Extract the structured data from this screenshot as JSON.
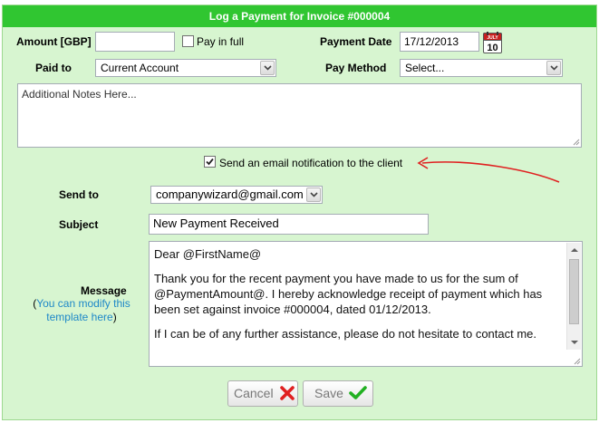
{
  "dialog": {
    "title": "Log a Payment for Invoice #000004"
  },
  "payment": {
    "amount_label": "Amount [GBP]",
    "amount_value": "",
    "pay_in_full_label": "Pay in full",
    "pay_in_full_checked": false,
    "date_label": "Payment Date",
    "date_value": "17/12/2013",
    "calendar_badge_month": "JULY",
    "calendar_badge_day": "10",
    "paid_to_label": "Paid to",
    "paid_to_value": "Current Account",
    "pay_method_label": "Pay Method",
    "pay_method_value": "Select...",
    "notes_placeholder": "Additional Notes Here..."
  },
  "email": {
    "notify_label": "Send an email notification to the client",
    "notify_checked": true,
    "send_to_label": "Send to",
    "send_to_value": "companywizard@gmail.com",
    "subject_label": "Subject",
    "subject_value": "New Payment Received",
    "message_label": "Message",
    "message_hint_open": "(",
    "message_hint_link": "You can modify this template here",
    "message_hint_close": ")",
    "message_lines": [
      "Dear @FirstName@",
      "Thank you for the recent payment you have made to us for the sum of @PaymentAmount@. I hereby acknowledge receipt of payment which has been set against invoice #000004, dated 01/12/2013.",
      "If I can be of any further assistance, please do not hesitate to contact me."
    ]
  },
  "actions": {
    "cancel_label": "Cancel",
    "save_label": "Save"
  },
  "colors": {
    "header": "#30c631",
    "panel": "#d7f5d0",
    "link": "#1e88c8",
    "annotation_arrow": "#e02020",
    "cancel_icon": "#e02020",
    "save_icon": "#22b022"
  }
}
